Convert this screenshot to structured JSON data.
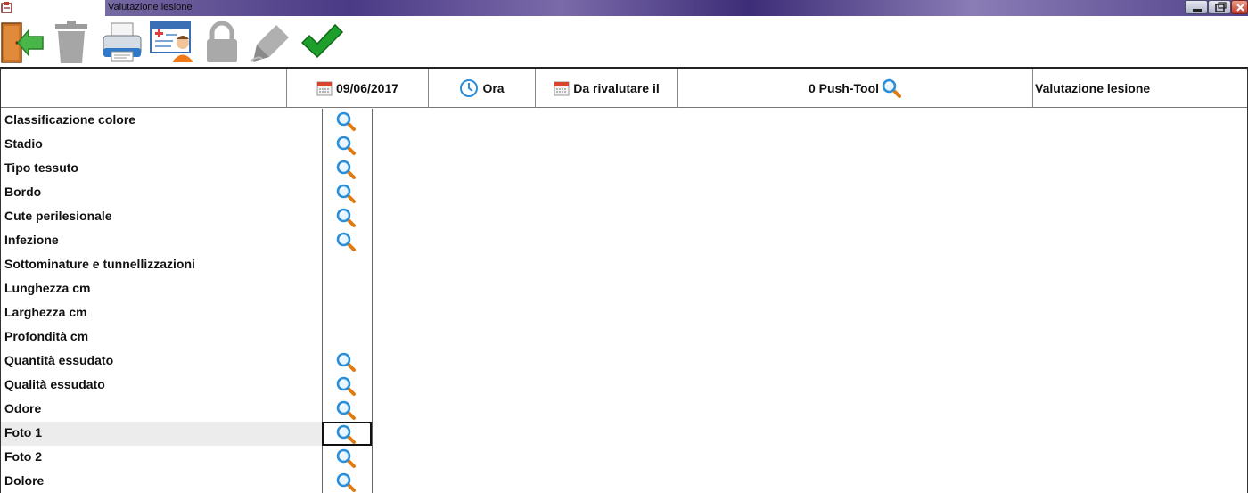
{
  "window": {
    "title": "Valutazione lesione",
    "accent_color": "#4a3a86"
  },
  "toolbar": {
    "buttons": [
      {
        "name": "exit-button",
        "icon": "exit-door-icon"
      },
      {
        "name": "delete-button",
        "icon": "trash-icon"
      },
      {
        "name": "print-button",
        "icon": "printer-icon"
      },
      {
        "name": "patient-record-button",
        "icon": "patient-card-icon"
      },
      {
        "name": "lock-button",
        "icon": "lock-icon"
      },
      {
        "name": "sign-button",
        "icon": "pen-icon"
      },
      {
        "name": "confirm-button",
        "icon": "checkmark-icon"
      }
    ]
  },
  "header": {
    "date": "09/06/2017",
    "time": "Ora",
    "revaluate": "Da rivalutare il",
    "push_tool": "0 Push-Tool",
    "evaluation": "Valutazione lesione"
  },
  "rows": [
    {
      "label": "Classificazione colore",
      "has_lookup": true
    },
    {
      "label": "Stadio",
      "has_lookup": true
    },
    {
      "label": "Tipo tessuto",
      "has_lookup": true
    },
    {
      "label": "Bordo",
      "has_lookup": true
    },
    {
      "label": "Cute perilesionale",
      "has_lookup": true
    },
    {
      "label": "Infezione",
      "has_lookup": true
    },
    {
      "label": "Sottominature e tunnellizzazioni",
      "has_lookup": false
    },
    {
      "label": "Lunghezza cm",
      "has_lookup": false
    },
    {
      "label": "Larghezza cm",
      "has_lookup": false
    },
    {
      "label": "Profondità cm",
      "has_lookup": false
    },
    {
      "label": "Quantità essudato",
      "has_lookup": true
    },
    {
      "label": "Qualità essudato",
      "has_lookup": true
    },
    {
      "label": "Odore",
      "has_lookup": true
    },
    {
      "label": "Foto 1",
      "has_lookup": true,
      "selected": true
    },
    {
      "label": "Foto 2",
      "has_lookup": true
    },
    {
      "label": "Dolore",
      "has_lookup": true
    }
  ]
}
